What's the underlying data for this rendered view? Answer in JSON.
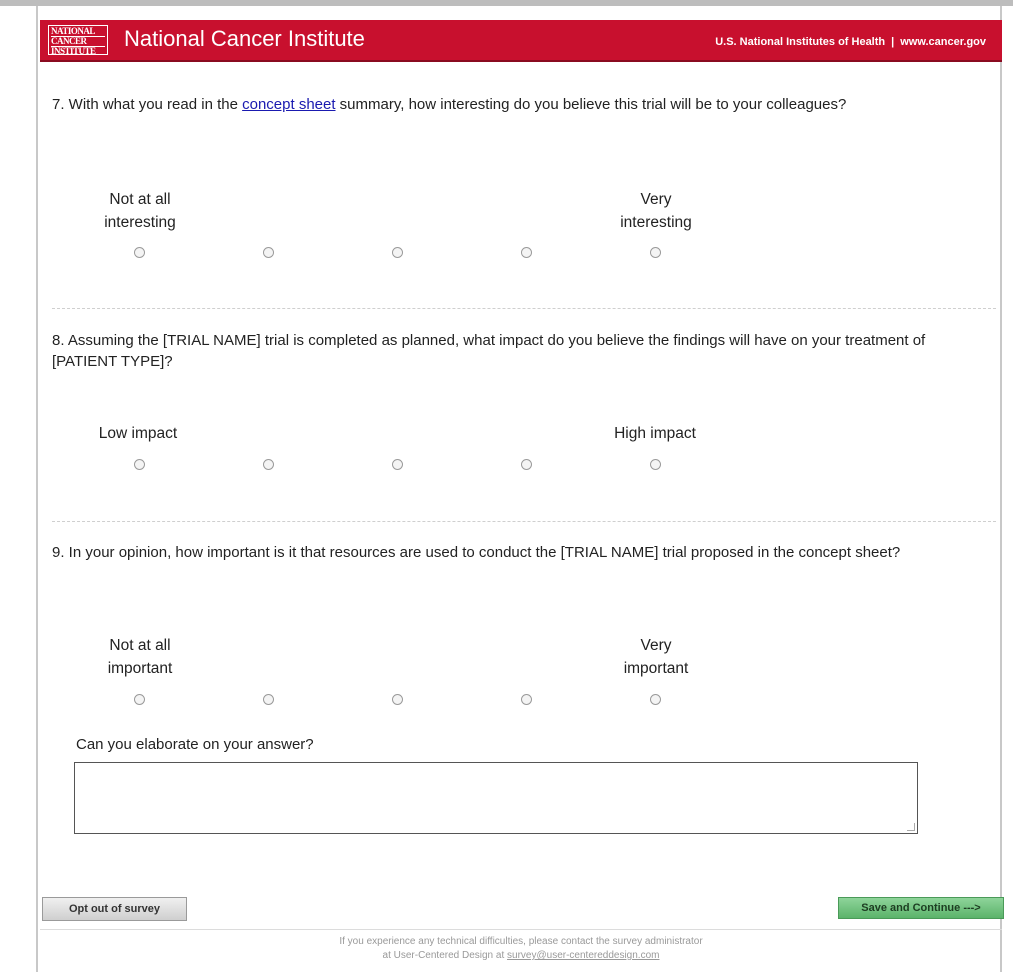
{
  "header": {
    "logo_lines": [
      "NATIONAL",
      "CANCER",
      "INSTITUTE"
    ],
    "title": "National Cancer Institute",
    "nih_link": "U.S. National Institutes of Health",
    "separator": "|",
    "site_link": "www.cancer.gov"
  },
  "q7": {
    "text_before": "7. With what you read in the ",
    "link": "concept sheet",
    "text_after": " summary, how interesting do you believe this trial will be to your colleagues?",
    "low_label": "Not at all\ninteresting",
    "high_label": "Very\ninteresting"
  },
  "q8": {
    "text": "8. Assuming the [TRIAL NAME] trial is completed as planned, what impact do you believe the findings will have on your treatment of [PATIENT TYPE]?",
    "low_label": "Low impact",
    "high_label": "High impact"
  },
  "q9": {
    "text": "9. In your opinion, how important is it that resources are used to conduct the [TRIAL NAME] trial proposed in the concept sheet?",
    "low_label": "Not at all\nimportant",
    "high_label": "Very\nimportant"
  },
  "elaborate": {
    "label": "Can you elaborate on your answer?",
    "value": ""
  },
  "buttons": {
    "opt_out": "Opt out of survey",
    "save": "Save and Continue --->"
  },
  "footer": {
    "line1": "If you experience any technical difficulties, please contact the survey administrator",
    "line2_prefix": "at User-Centered Design at ",
    "email": "survey@user-centereddesign.com"
  },
  "colors": {
    "header_bg": "#c8102e",
    "save_button": "#5bb36a",
    "link": "#1a1ab0"
  }
}
